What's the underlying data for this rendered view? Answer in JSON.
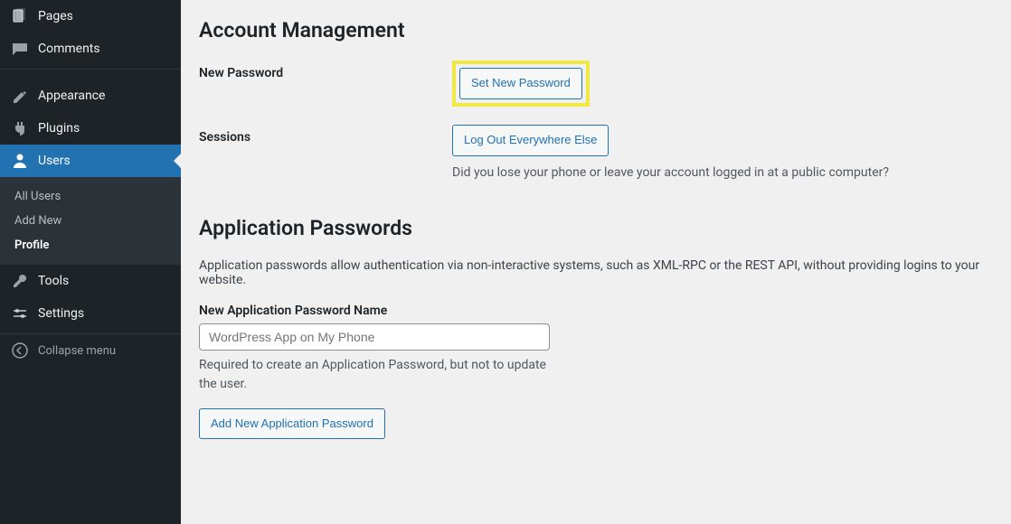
{
  "sidebar": {
    "pages": "Pages",
    "comments": "Comments",
    "appearance": "Appearance",
    "plugins": "Plugins",
    "users": "Users",
    "tools": "Tools",
    "settings": "Settings",
    "collapse": "Collapse menu"
  },
  "submenu": {
    "all_users": "All Users",
    "add_new": "Add New",
    "profile": "Profile"
  },
  "account": {
    "title": "Account Management",
    "new_password_label": "New Password",
    "set_new_password": "Set New Password",
    "sessions_label": "Sessions",
    "logout_everywhere": "Log Out Everywhere Else",
    "sessions_help": "Did you lose your phone or leave your account logged in at a public computer?"
  },
  "app_passwords": {
    "title": "Application Passwords",
    "description": "Application passwords allow authentication via non-interactive systems, such as XML-RPC or the REST API, without providing logins to your website.",
    "name_label": "New Application Password Name",
    "name_placeholder": "WordPress App on My Phone",
    "name_help": "Required to create an Application Password, but not to update the user.",
    "add_button": "Add New Application Password"
  }
}
